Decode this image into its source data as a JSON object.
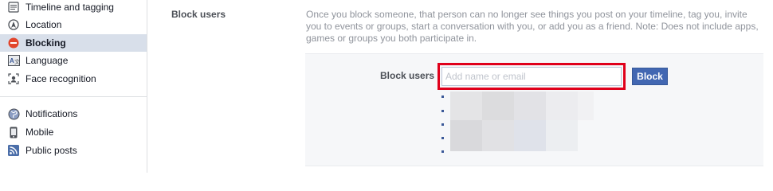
{
  "sidebar": {
    "group1": [
      {
        "label": "Timeline and tagging",
        "icon": "timeline-icon",
        "selected": false
      },
      {
        "label": "Location",
        "icon": "location-icon",
        "selected": false
      },
      {
        "label": "Blocking",
        "icon": "blocking-icon",
        "selected": true
      },
      {
        "label": "Language",
        "icon": "language-icon",
        "selected": false
      },
      {
        "label": "Face recognition",
        "icon": "face-recognition-icon",
        "selected": false
      }
    ],
    "group2": [
      {
        "label": "Notifications",
        "icon": "globe-icon",
        "selected": false
      },
      {
        "label": "Mobile",
        "icon": "mobile-icon",
        "selected": false
      },
      {
        "label": "Public posts",
        "icon": "rss-icon",
        "selected": false
      }
    ]
  },
  "section": {
    "title": "Block users",
    "description": "Once you block someone, that person can no longer see things you post on your timeline, tag you, invite you to events or groups, start a conversation with you, or add you as a friend. Note: Does not include apps, games or groups you both participate in."
  },
  "block_form": {
    "label": "Block users",
    "input_placeholder": "Add name or email",
    "input_value": "",
    "button_label": "Block"
  },
  "blocked_users_count": 5,
  "colors": {
    "selected_nav_bg": "#d8dfea",
    "button_bg": "#4267b2",
    "highlight_border": "#e0001b",
    "bullet": "#3b5998"
  }
}
